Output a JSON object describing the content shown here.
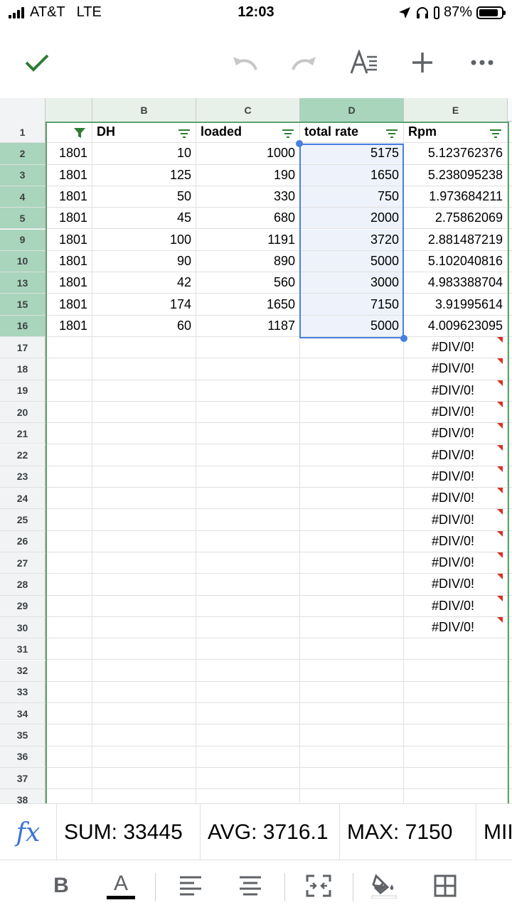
{
  "status_bar": {
    "carrier": "AT&T",
    "network": "LTE",
    "time": "12:03",
    "battery": "87%",
    "battery_level": 0.87
  },
  "toolbar": {
    "icons": [
      "checkmark-icon",
      "undo-icon",
      "redo-icon",
      "text-format-icon",
      "add-icon",
      "more-icon"
    ],
    "accent": "#2e7d32"
  },
  "columns": [
    "",
    "B",
    "C",
    "D",
    "E"
  ],
  "selected_column": "D",
  "header_row": {
    "row_num": "1",
    "cells": [
      "",
      "DH",
      "loaded",
      "total rate",
      "Rpm"
    ]
  },
  "data_rows": [
    {
      "row_num": "2",
      "values": [
        "1801",
        "10",
        "1000",
        "5175",
        "5.123762376"
      ]
    },
    {
      "row_num": "3",
      "values": [
        "1801",
        "125",
        "190",
        "1650",
        "5.238095238"
      ]
    },
    {
      "row_num": "4",
      "values": [
        "1801",
        "50",
        "330",
        "750",
        "1.973684211"
      ]
    },
    {
      "row_num": "5",
      "values": [
        "1801",
        "45",
        "680",
        "2000",
        "2.75862069"
      ]
    },
    {
      "row_num": "9",
      "values": [
        "1801",
        "100",
        "1191",
        "3720",
        "2.881487219"
      ]
    },
    {
      "row_num": "10",
      "values": [
        "1801",
        "90",
        "890",
        "5000",
        "5.102040816"
      ]
    },
    {
      "row_num": "13",
      "values": [
        "1801",
        "42",
        "560",
        "3000",
        "4.983388704"
      ]
    },
    {
      "row_num": "15",
      "values": [
        "1801",
        "174",
        "1650",
        "7150",
        "3.91995614"
      ]
    },
    {
      "row_num": "16",
      "values": [
        "1801",
        "60",
        "1187",
        "5000",
        "4.009623095"
      ]
    }
  ],
  "error_rows": [
    "17",
    "18",
    "19",
    "20",
    "21",
    "22",
    "23",
    "24",
    "25",
    "26",
    "27",
    "28",
    "29",
    "30"
  ],
  "error_text": "#DIV/0!",
  "empty_rows": [
    "31",
    "32",
    "33",
    "34",
    "35",
    "36",
    "37",
    "38"
  ],
  "function_bar": {
    "fx": "fx",
    "sum": "SUM: 33445",
    "avg": "AVG: 3716.1",
    "max": "MAX: 7150",
    "min": "MII"
  },
  "format_bar": {
    "bold": "B",
    "text_color": "A",
    "text_color_value": "#000000"
  }
}
